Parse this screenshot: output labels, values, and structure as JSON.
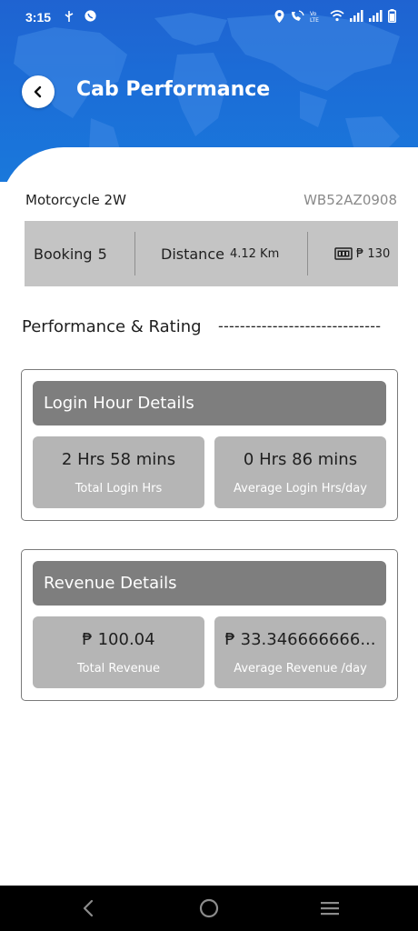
{
  "status_bar": {
    "time": "3:15",
    "left_icons": [
      "usb-icon",
      "whatsapp-icon"
    ],
    "right_icons": [
      "location-icon",
      "wifi-calling-icon",
      "volte-icon",
      "wifi-icon",
      "signal-icon",
      "signal-icon",
      "battery-icon"
    ]
  },
  "header": {
    "title": "Cab Performance",
    "back_icon": "chevron-left-icon",
    "background_color": "#1b6fd8"
  },
  "vehicle": {
    "type": "Motorcycle 2W",
    "number": "WB52AZ0908"
  },
  "summary": {
    "booking_label": "Booking",
    "booking_value": "5",
    "distance_label": "Distance",
    "distance_value": "4.12 Km",
    "fare_icon": "taximeter-icon",
    "fare_value": "₱ 130"
  },
  "section": {
    "title": "Performance & Rating",
    "dashes": "------------------------------"
  },
  "login_card": {
    "title": "Login Hour Details",
    "total_value": "2 Hrs 58 mins",
    "total_label": "Total Login Hrs",
    "average_value": "0 Hrs 86 mins",
    "average_label": "Average Login Hrs/day"
  },
  "revenue_card": {
    "title": "Revenue Details",
    "total_value": "₱ 100.04",
    "total_label": "Total Revenue",
    "average_value": "₱ 33.346666666...",
    "average_label": "Average Revenue /day"
  },
  "nav_bar": {
    "icons": [
      "back-nav-icon",
      "home-nav-icon",
      "recents-nav-icon"
    ]
  }
}
